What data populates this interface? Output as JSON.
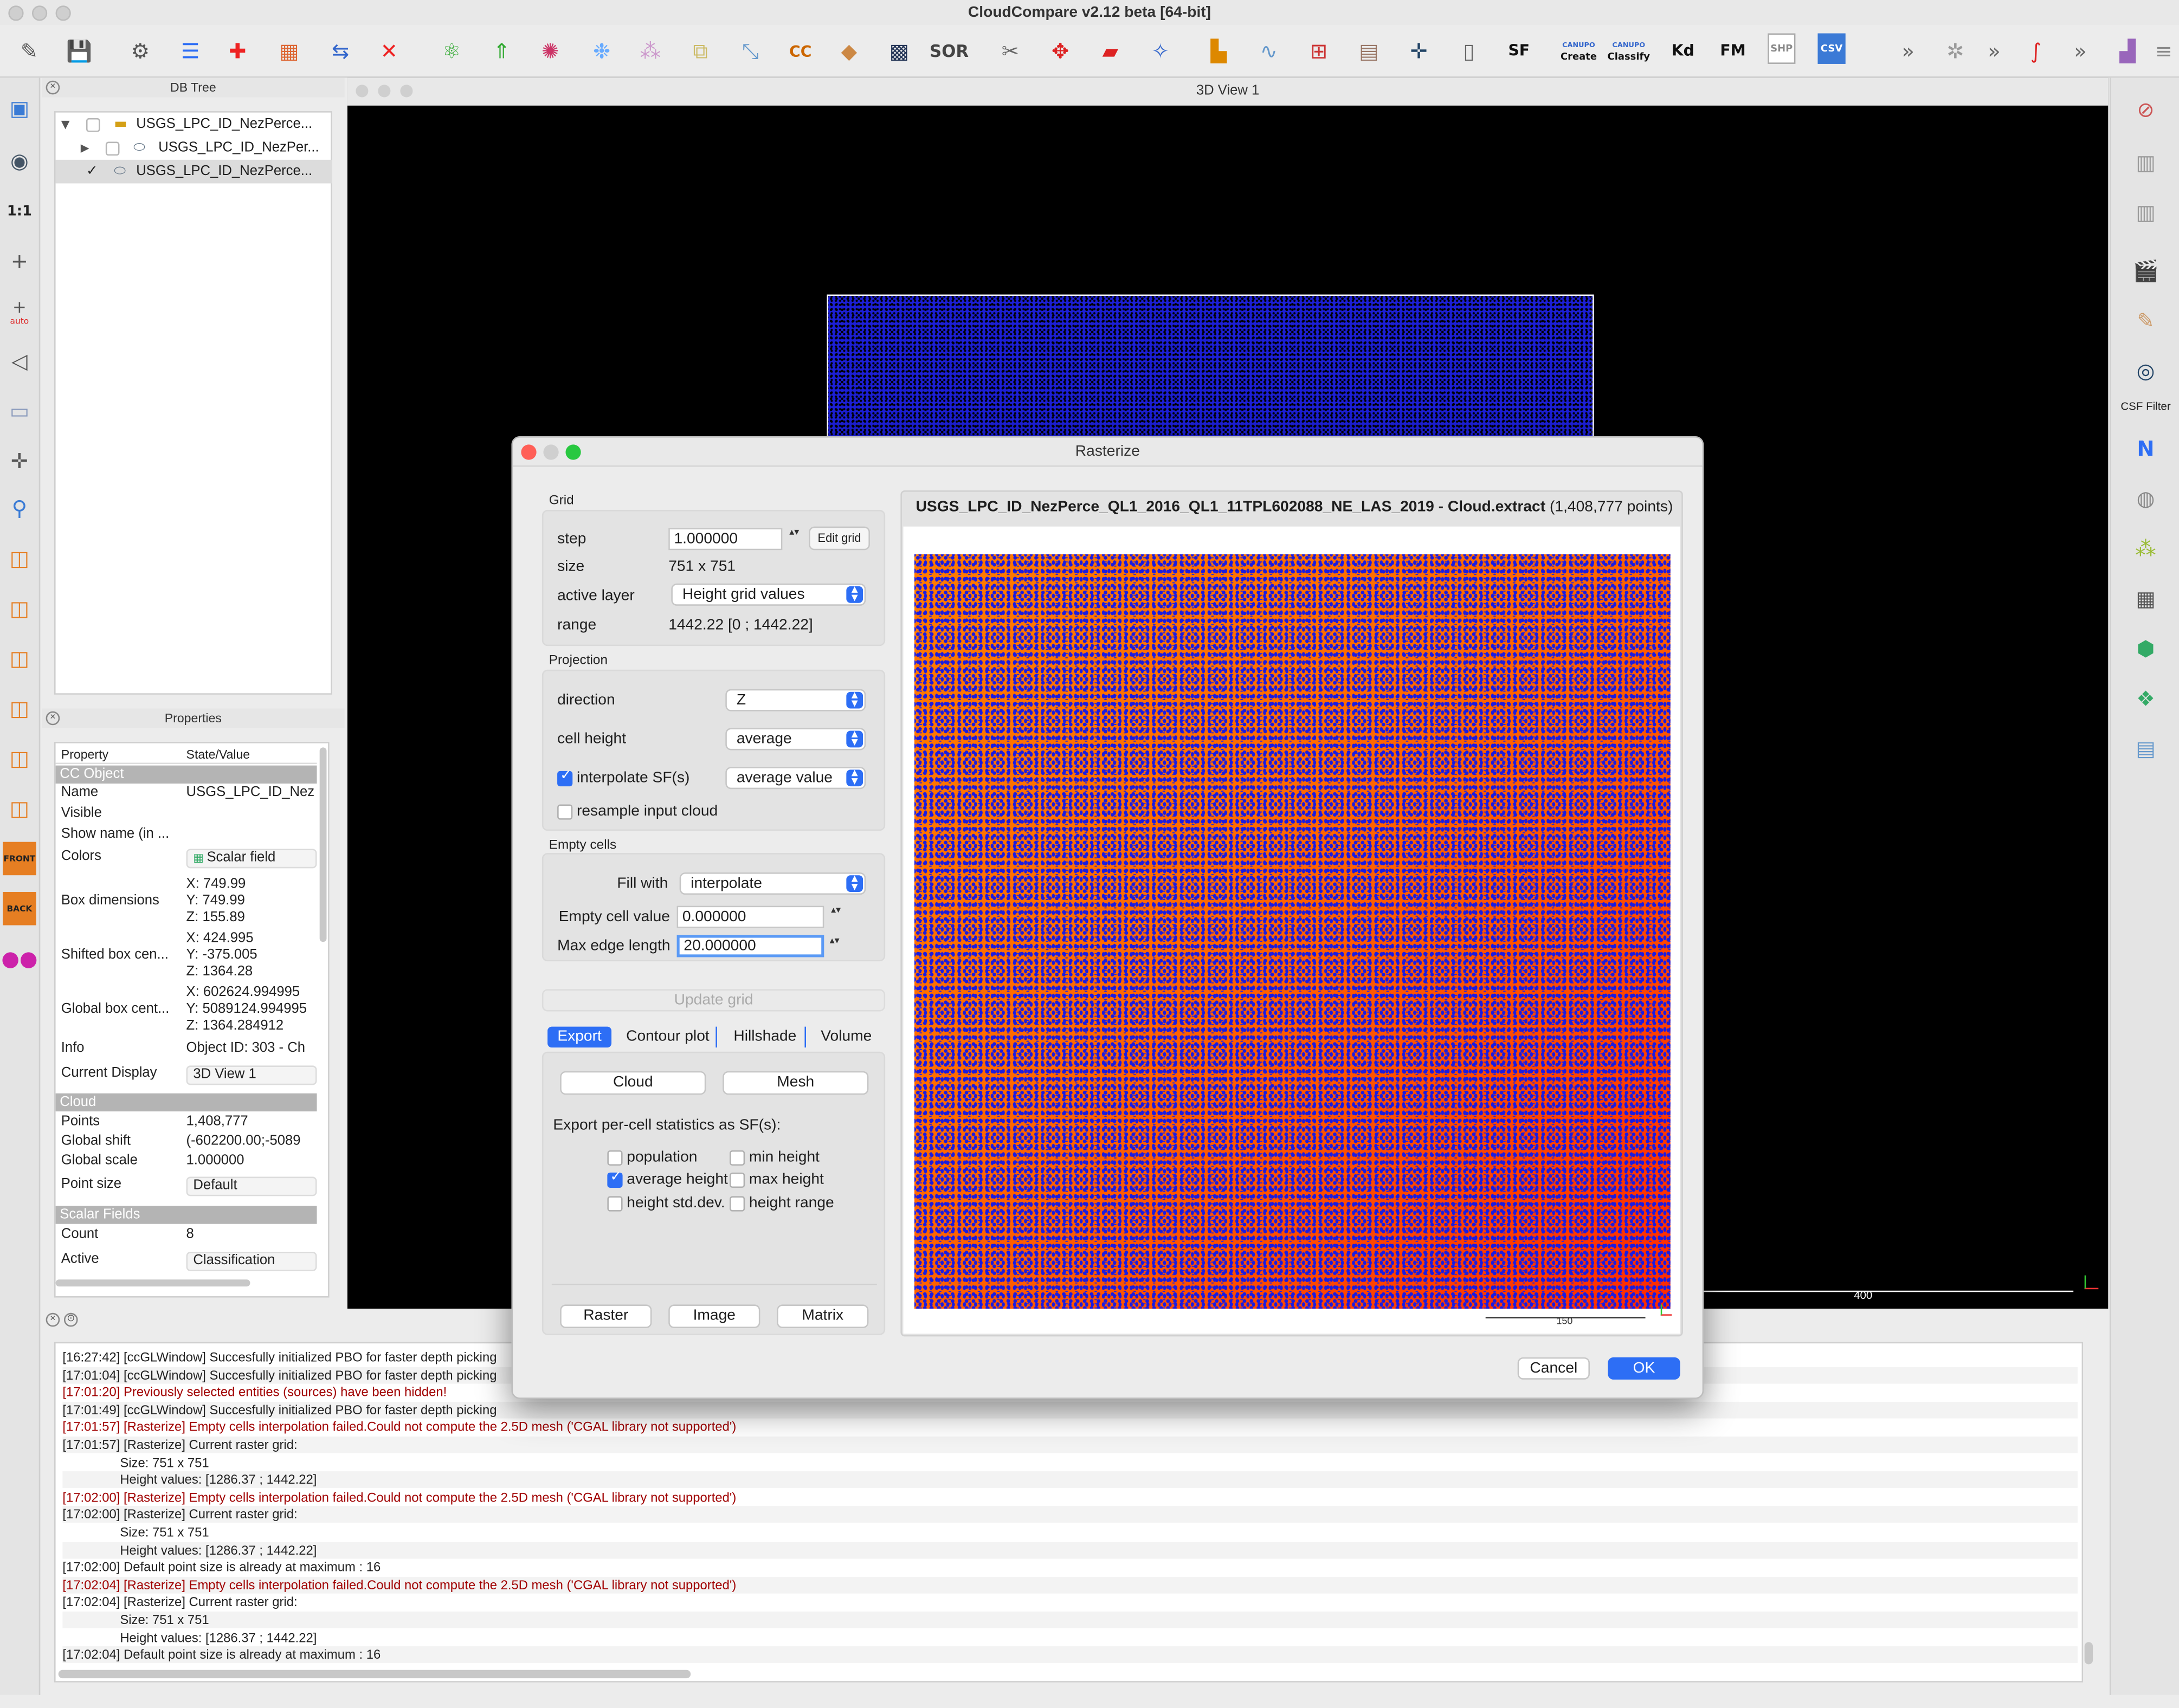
{
  "window": {
    "title": "CloudCompare v2.12 beta [64-bit]"
  },
  "toolbar": {
    "sor_label": "SOR",
    "sf_label": "SF",
    "canupo_label": "CANUPO",
    "create_label": "Create",
    "classify_label": "Classify",
    "kd_label": "Kd",
    "fm_label": "FM",
    "shp_label": "SHP",
    "csv_label": "CSV",
    "overflow": "»"
  },
  "left_toolbar": {
    "one_to_one": "1:1",
    "auto": "auto",
    "front": "FRONT",
    "back": "BACK"
  },
  "right_toolbar": {
    "csf_filter": "CSF Filter",
    "north": "N"
  },
  "db_tree": {
    "title": "DB Tree",
    "items": [
      {
        "label": "USGS_LPC_ID_NezPerce..."
      },
      {
        "label": "USGS_LPC_ID_NezPer..."
      },
      {
        "label": "USGS_LPC_ID_NezPerce..."
      }
    ]
  },
  "properties": {
    "title": "Properties",
    "col_property": "Property",
    "col_state": "State/Value",
    "sec_ccobject": "CC Object",
    "name_k": "Name",
    "name_v": "USGS_LPC_ID_Nez",
    "visible_k": "Visible",
    "showname_k": "Show name (in ...",
    "colors_k": "Colors",
    "colors_v": "Scalar field",
    "boxdim_k": "Box dimensions",
    "boxdim_x": "X: 749.99",
    "boxdim_y": "Y: 749.99",
    "boxdim_z": "Z: 155.89",
    "shifted_k": "Shifted box cen...",
    "shifted_x": "X: 424.995",
    "shifted_y": "Y: -375.005",
    "shifted_z": "Z: 1364.28",
    "global_k": "Global box cent...",
    "global_x": "X: 602624.994995",
    "global_y": "Y: 5089124.994995",
    "global_z": "Z: 1364.284912",
    "info_k": "Info",
    "info_v": "Object ID: 303 - Ch",
    "display_k": "Current Display",
    "display_v": "3D View 1",
    "sec_cloud": "Cloud",
    "points_k": "Points",
    "points_v": "1,408,777",
    "gshift_k": "Global shift",
    "gshift_v": "(-602200.00;-5089",
    "gscale_k": "Global scale",
    "gscale_v": "1.000000",
    "psize_k": "Point size",
    "psize_v": "Default",
    "sec_sf": "Scalar Fields",
    "count_k": "Count",
    "count_v": "8",
    "active_k": "Active",
    "active_v": "Classification"
  },
  "view3d": {
    "title": "3D View 1",
    "scale_label": "400"
  },
  "dialog": {
    "title": "Rasterize",
    "grid": {
      "title": "Grid",
      "step_label": "step",
      "step_value": "1.000000",
      "edit_grid": "Edit grid",
      "size_label": "size",
      "size_value": "751 x 751",
      "active_layer_label": "active layer",
      "active_layer_value": "Height grid values",
      "range_label": "range",
      "range_value": "1442.22 [0 ; 1442.22]"
    },
    "projection": {
      "title": "Projection",
      "direction_label": "direction",
      "direction_value": "Z",
      "cell_height_label": "cell height",
      "cell_height_value": "average",
      "interpolate_label": "interpolate SF(s)",
      "interpolate_value": "average value",
      "resample_label": "resample input cloud"
    },
    "empty": {
      "title": "Empty cells",
      "fill_label": "Fill with",
      "fill_value": "interpolate",
      "ecv_label": "Empty cell value",
      "ecv_value": "0.000000",
      "mel_label": "Max edge length",
      "mel_value": "20.000000"
    },
    "update_grid": "Update grid",
    "tabs": [
      "Export",
      "Contour plot",
      "Hillshade",
      "Volume"
    ],
    "export": {
      "cloud": "Cloud",
      "mesh": "Mesh",
      "stats_label": "Export per-cell statistics as SF(s):",
      "population": "population",
      "min_height": "min height",
      "average_height": "average height",
      "max_height": "max height",
      "height_stddev": "height std.dev.",
      "height_range": "height range",
      "raster": "Raster",
      "image": "Image",
      "matrix": "Matrix"
    },
    "preview": {
      "title_bold": "USGS_LPC_ID_NezPerce_QL1_2016_QL1_11TPL602088_NE_LAS_2019 - Cloud.extract",
      "title_count": "(1,408,777 points)",
      "scale_label": "150"
    },
    "cancel": "Cancel",
    "ok": "OK"
  },
  "console": {
    "lines": [
      {
        "t": "[16:27:42] [ccGLWindow] Succesfully initialized PBO for faster depth picking",
        "red": false
      },
      {
        "t": "[17:01:04] [ccGLWindow] Succesfully initialized PBO for faster depth picking",
        "red": false
      },
      {
        "t": "[17:01:20] Previously selected entities (sources) have been hidden!",
        "red": true
      },
      {
        "t": "[17:01:49] [ccGLWindow] Succesfully initialized PBO for faster depth picking",
        "red": false
      },
      {
        "t": "[17:01:57] [Rasterize] Empty cells interpolation failed.Could not compute the 2.5D mesh ('CGAL library not supported')",
        "red": true
      },
      {
        "t": "[17:01:57] [Rasterize] Current raster grid:",
        "red": false
      },
      {
        "t": "                Size: 751 x 751",
        "red": false
      },
      {
        "t": "                Height values: [1286.37 ; 1442.22]",
        "red": false
      },
      {
        "t": "[17:02:00] [Rasterize] Empty cells interpolation failed.Could not compute the 2.5D mesh ('CGAL library not supported')",
        "red": true
      },
      {
        "t": "[17:02:00] [Rasterize] Current raster grid:",
        "red": false
      },
      {
        "t": "                Size: 751 x 751",
        "red": false
      },
      {
        "t": "                Height values: [1286.37 ; 1442.22]",
        "red": false
      },
      {
        "t": "[17:02:00] Default point size is already at maximum : 16",
        "red": false
      },
      {
        "t": "[17:02:04] [Rasterize] Empty cells interpolation failed.Could not compute the 2.5D mesh ('CGAL library not supported')",
        "red": true
      },
      {
        "t": "[17:02:04] [Rasterize] Current raster grid:",
        "red": false
      },
      {
        "t": "                Size: 751 x 751",
        "red": false
      },
      {
        "t": "                Height values: [1286.37 ; 1442.22]",
        "red": false
      },
      {
        "t": "[17:02:04] Default point size is already at maximum : 16",
        "red": false
      }
    ]
  },
  "colors": {
    "accent": "#2d6ef5",
    "error": "#a00000",
    "cloud_blue": "#1b1be0",
    "raster_orange": "#ff6a00"
  }
}
